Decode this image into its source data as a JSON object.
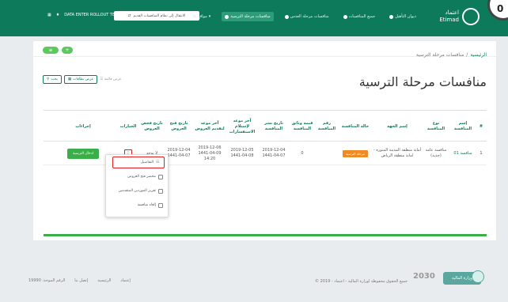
{
  "topbar": {
    "user_label": "DATA ENTER ROLLOUT TEAM",
    "lang_label": "الانتقال إلى نظام المنافسات القديم",
    "logo_text_ar": "اعتماد",
    "logo_text_en": "Etimad",
    "corner_label": "0",
    "nav": [
      {
        "label": "ديوان التأهيل"
      },
      {
        "label": "جميع المنافسات"
      },
      {
        "label": "منافسات مرحلة العدس"
      },
      {
        "label": "منافسات مرحلة الترسية"
      },
      {
        "label": "مواقع"
      }
    ]
  },
  "card": {
    "add_label": "+",
    "filter_label": "≡",
    "breadcrumb_home": "الرئيسية",
    "breadcrumb_sep": "/",
    "breadcrumb_current": "منافسات مرحلة الترسية",
    "title": "منافسات مرحلة الترسية",
    "search_button": "بحث",
    "view_cards_button": "عرض بطاقات",
    "view_list_label": "عرض قائمة"
  },
  "table": {
    "headers": {
      "num": "#",
      "name": "إسم المنافسة",
      "type": "نوع المنافسة",
      "agency": "إسم الجهة",
      "status": "حالة المنافسة",
      "ref": "رقم المنافسة",
      "doc_value": "قيمة وثائق المنافسة",
      "pub_date": "تاريخ نشر المنافسة",
      "inquiry_deadline": "آخر موعد لإستلام الاستفسارات",
      "bid_deadline": "آخر موعد لتقديم العروض",
      "open_date": "تاريخ فتح العروض",
      "exam_date": "تاريخ فحص العروض",
      "options": "الخيارات",
      "actions": "إجراءات"
    },
    "row": {
      "num": "1",
      "name": "منافسة 01",
      "type": "منافسة عامة (جديد)",
      "agency": "أمانة منطقة المدينة المنورة - امانة منطقة الرياض",
      "status": "مرحلة الترسية",
      "ref": "",
      "doc_value": "0",
      "pub_date_g": "2019-12-04",
      "pub_date_h": "1441-04-07",
      "inquiry_g": "2019-12-05",
      "inquiry_h": "1441-04-08",
      "bid_g": "2019-12-06",
      "bid_h": "1441-04-09",
      "bid_time": "14:20",
      "open_g": "2019-12-04",
      "open_h": "1441-04-07",
      "exam": "لا يوجد",
      "options_glyph": "⋮",
      "action_label": "ادخال الترسية"
    }
  },
  "dropdown": {
    "items": [
      {
        "label": "التفاصيل"
      },
      {
        "label": "محضر فتح العروض"
      },
      {
        "label": "تقرير الموردين المتقدمين"
      },
      {
        "label": "إلغاء منافسة"
      }
    ]
  },
  "footer": {
    "links": [
      {
        "label": "الرقم الموحد: 19990"
      },
      {
        "label": "إتصل بنا"
      },
      {
        "label": "الرئيسية"
      },
      {
        "label": "إعتماد"
      }
    ],
    "copyright": "© جميع الحقوق محفوظة لوزارة المالية - اعتماد - 2019",
    "vision_label": "2030",
    "mof_label": "وزارة المالية"
  }
}
